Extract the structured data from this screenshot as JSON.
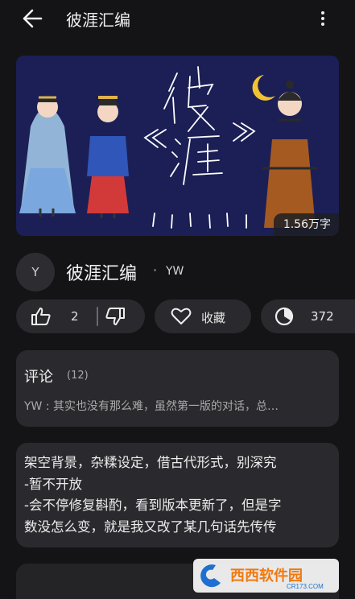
{
  "header": {
    "title": "彼涯汇编"
  },
  "cover": {
    "title_art": "彼涯",
    "word_count": "1.56万字"
  },
  "work": {
    "avatar_letter": "Y",
    "title": "彼涯汇编",
    "separator": "·",
    "author": "YW"
  },
  "actions": {
    "like_count": "2",
    "favorite_label": "收藏",
    "read_count": "372"
  },
  "comments": {
    "title": "评论",
    "count": "(12)",
    "preview": "YW : 其实也没有那么难，虽然第一版的对话，总…"
  },
  "description": {
    "lines": [
      "架空背景，杂糅设定，借古代形式，别深究",
      "-暂不开放",
      "-会不停修复斟酌，看到版本更新了，但是字",
      "数没怎么变，就是我又改了某几句话先传传"
    ]
  },
  "watermark": {
    "brand": "西西软件园",
    "url": "CR173.COM"
  },
  "colors": {
    "background": "#141416",
    "card": "#2a2a2e",
    "cover_bg": "#1b1f55",
    "moon": "#f2c230"
  }
}
